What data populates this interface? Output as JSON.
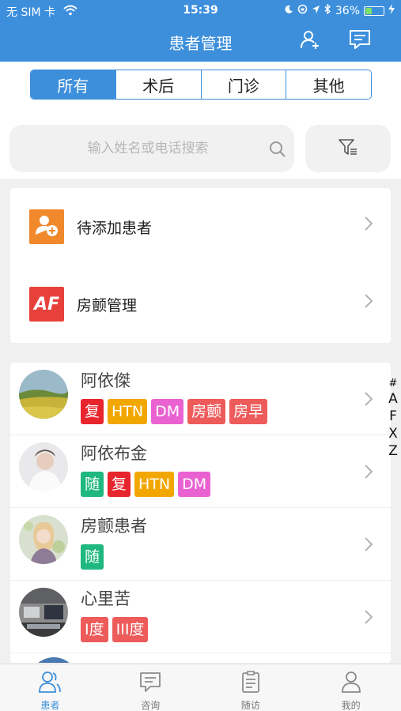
{
  "status_bar": {
    "carrier": "无 SIM 卡",
    "time": "15:39",
    "battery_percent": "36%",
    "battery_level": 0.36
  },
  "header": {
    "title": "患者管理",
    "add_patient_icon": "person-plus-icon",
    "message_icon": "chat-box-icon"
  },
  "segments": [
    {
      "label": "所有",
      "active": true
    },
    {
      "label": "术后",
      "active": false
    },
    {
      "label": "门诊",
      "active": false
    },
    {
      "label": "其他",
      "active": false
    }
  ],
  "search": {
    "placeholder": "输入姓名或电话搜索",
    "value": ""
  },
  "filter_icon": "filter-icon",
  "menu": [
    {
      "label": "待添加患者",
      "icon": "add-user-icon",
      "icon_color": "#f0892c"
    },
    {
      "label": "房颤管理",
      "icon_text": "AF",
      "icon_color": "#e8413c"
    }
  ],
  "patients": [
    {
      "name": "阿依傑",
      "tags": [
        "复",
        "HTN",
        "DM",
        "房颤",
        "房早"
      ]
    },
    {
      "name": "阿依布金",
      "tags": [
        "随",
        "复",
        "HTN",
        "DM"
      ]
    },
    {
      "name": "房颤患者",
      "tags": [
        "随"
      ]
    },
    {
      "name": "心里苦",
      "tags": [
        "I度",
        "III度"
      ]
    }
  ],
  "tag_colors": {
    "复": "#e8242d",
    "HTN": "#f2a700",
    "DM": "#ea62d2",
    "房颤": "#ee5b5b",
    "房早": "#ee5b5b",
    "随": "#1fb881",
    "I度": "#ee5b5b",
    "III度": "#ee5b5b"
  },
  "index_letters": [
    "#",
    "A",
    "F",
    "X",
    "Z"
  ],
  "tabs": [
    {
      "label": "患者",
      "icon": "patients-icon",
      "active": true
    },
    {
      "label": "咨询",
      "icon": "consult-icon",
      "active": false
    },
    {
      "label": "随访",
      "icon": "followup-icon",
      "active": false
    },
    {
      "label": "我的",
      "icon": "profile-icon",
      "active": false
    }
  ],
  "colors": {
    "primary": "#3d8fdc",
    "background": "#f0f0f0"
  }
}
